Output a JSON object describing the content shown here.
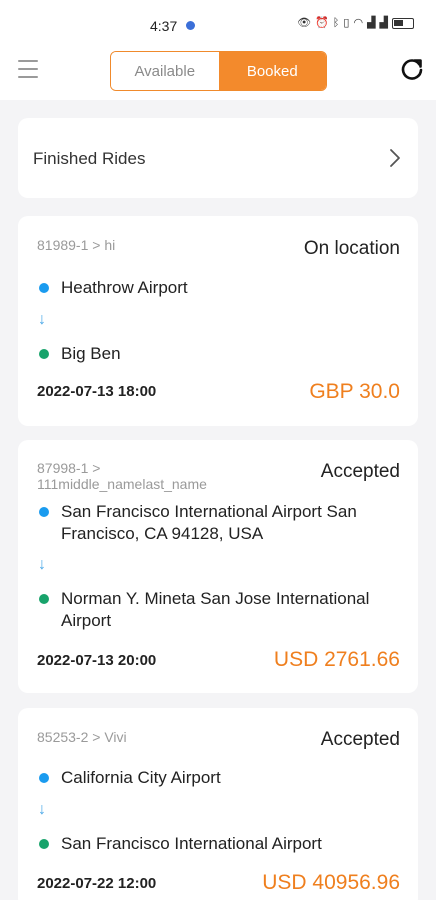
{
  "status_bar": {
    "time": "4:37",
    "icons": [
      "eye-icon",
      "alarm-icon",
      "bluetooth-icon",
      "vibrate-icon",
      "wifi-icon",
      "signal-icon",
      "signal-icon",
      "battery-icon"
    ]
  },
  "header": {
    "tabs": [
      {
        "label": "Available",
        "active": false
      },
      {
        "label": "Booked",
        "active": true
      }
    ]
  },
  "finished_rides": {
    "label": "Finished Rides"
  },
  "rides": [
    {
      "id_line": "81989-1 > hi",
      "status": "On location",
      "pickup": "Heathrow Airport",
      "dropoff": "Big Ben",
      "datetime": "2022-07-13 18:00",
      "price": "GBP 30.0"
    },
    {
      "id_line_1": "87998-1 >",
      "id_line_2": "111middle_namelast_name",
      "status": "Accepted",
      "pickup_1": "San Francisco International Airport San",
      "pickup_2": "Francisco, CA 94128, USA",
      "dropoff_1": "Norman Y. Mineta San Jose International",
      "dropoff_2": "Airport",
      "datetime": "2022-07-13 20:00",
      "price": "USD 2761.66"
    },
    {
      "id_line": "85253-2 > Vivi",
      "status": "Accepted",
      "pickup": "California City Airport",
      "dropoff": "San Francisco International Airport",
      "datetime": "2022-07-22 12:00",
      "price": "USD 40956.96"
    }
  ],
  "colors": {
    "accent": "#f38a2c",
    "pickup_dot": "#1a9bef",
    "dropoff_dot": "#18a36b",
    "price": "#ef7f1e"
  }
}
